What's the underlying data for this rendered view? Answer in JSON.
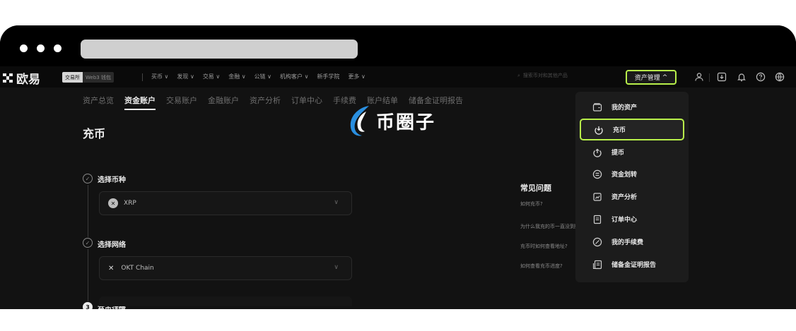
{
  "browser": {
    "url": ""
  },
  "nav": {
    "logo_text": "欧易",
    "mode_exchange": "交易所",
    "mode_web3": "Web3 钱包",
    "items": [
      "买币 ∨",
      "发现 ∨",
      "交易 ∨",
      "金融 ∨",
      "公链 ∨",
      "机构客户 ∨",
      "新手学院",
      "更多 ∨"
    ],
    "search_placeholder": "搜索币对和其他产品",
    "asset_button_label": "资产管理",
    "asset_button_chevron": "^"
  },
  "subtabs": [
    "资产总览",
    "资金账户",
    "交易账户",
    "金融账户",
    "资产分析",
    "订单中心",
    "手续费",
    "账户结单",
    "储备金证明报告"
  ],
  "active_subtab": "资金账户",
  "page": {
    "title": "充币",
    "step1_label": "选择币种",
    "step1_value": "XRP",
    "step2_label": "选择网络",
    "step2_value": "OKT Chain",
    "step3_number": "3",
    "step3_label": "充币详情"
  },
  "faq": {
    "title": "常见问题",
    "items": [
      "如何充币?",
      "为什么我充的币一直没到账?",
      "充币时如何查看地址?",
      "如何查看充币进度?"
    ]
  },
  "watermark": {
    "text": "币圈子"
  },
  "dropdown": {
    "items": [
      {
        "label": "我的资产",
        "icon": "wallet-icon"
      },
      {
        "label": "充币",
        "icon": "deposit-icon"
      },
      {
        "label": "提币",
        "icon": "withdraw-icon"
      },
      {
        "label": "资金划转",
        "icon": "transfer-icon"
      },
      {
        "label": "资产分析",
        "icon": "analysis-icon"
      },
      {
        "label": "订单中心",
        "icon": "order-icon"
      },
      {
        "label": "我的手续费",
        "icon": "fee-icon"
      },
      {
        "label": "储备金证明报告",
        "icon": "report-icon"
      }
    ],
    "active_index": 1
  },
  "colors": {
    "accent": "#b8f04a",
    "background": "#121212",
    "navbar": "#0a0a0a"
  }
}
